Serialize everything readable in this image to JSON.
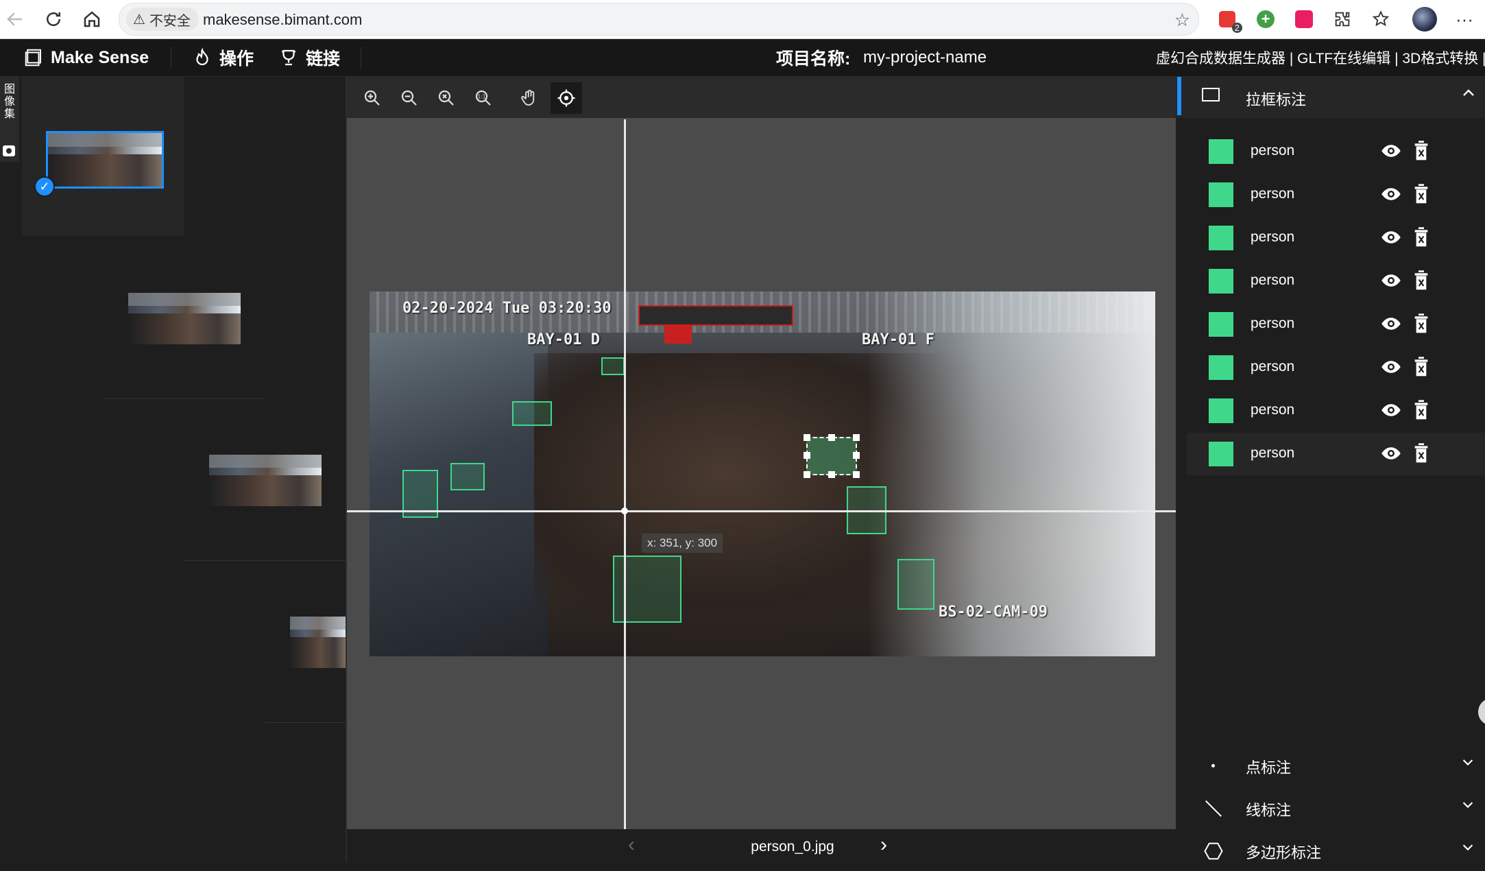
{
  "browser": {
    "security_label": "不安全",
    "url": "makesense.bimant.com",
    "ext_badge": "2"
  },
  "header": {
    "brand": "Make Sense",
    "menu_actions": "操作",
    "menu_links": "链接",
    "project_label": "项目名称:",
    "project_name": "my-project-name",
    "links_text": "虚幻合成数据生成器 | GLTF在线编辑 | 3D格式转换 | Bim"
  },
  "left_tab": {
    "label": "图像集"
  },
  "editor": {
    "osd_datetime": "02-20-2024 Tue 03:20:30",
    "osd_bay_left": "BAY-01 D",
    "osd_bay_right": "BAY-01 F",
    "osd_camera": "BS-02-CAM-09",
    "coord_tip": "x: 351, y: 300",
    "filename": "person_0.jpg",
    "prev_glyph": "‹",
    "next_glyph": "›"
  },
  "right_panel": {
    "rect_section_title": "拉框标注",
    "labels": [
      {
        "name": "person",
        "color": "#3fd88a"
      },
      {
        "name": "person",
        "color": "#3fd88a"
      },
      {
        "name": "person",
        "color": "#3fd88a"
      },
      {
        "name": "person",
        "color": "#3fd88a"
      },
      {
        "name": "person",
        "color": "#3fd88a"
      },
      {
        "name": "person",
        "color": "#3fd88a"
      },
      {
        "name": "person",
        "color": "#3fd88a"
      },
      {
        "name": "person",
        "color": "#3fd88a"
      }
    ],
    "point_section_title": "点标注",
    "line_section_title": "线标注",
    "polygon_section_title": "多边形标注"
  },
  "colors": {
    "accent": "#1e90ff",
    "label_green": "#3fd88a"
  }
}
